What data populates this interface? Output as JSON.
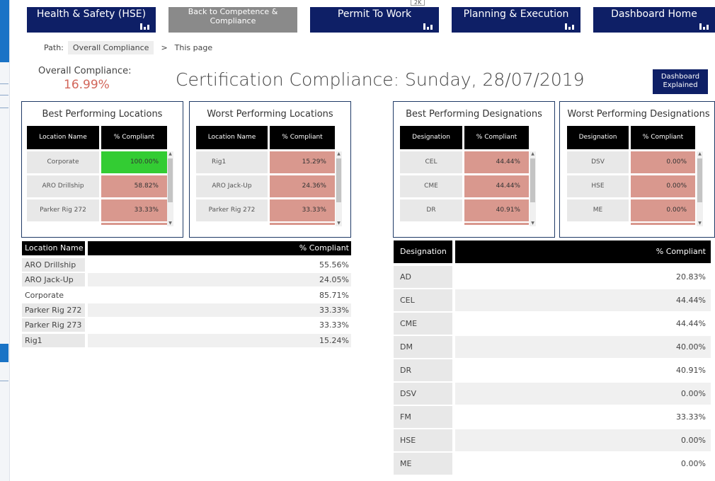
{
  "top_badge": "2K",
  "nav": {
    "hse": "Health & Safety (HSE)",
    "back": "Back to Competence & Compliance",
    "permit": "Permit To Work",
    "planning": "Planning & Execution",
    "home": "Dashboard Home"
  },
  "path": {
    "label": "Path:",
    "crumb": "Overall Compliance",
    "sep": ">",
    "current": "This page"
  },
  "overall": {
    "label": "Overall Compliance:",
    "value": "16.99%"
  },
  "title": "Certification Compliance: Sunday, 28/07/2019",
  "explain_button": "Dashboard Explained",
  "colors": {
    "nav": "#0e1f66",
    "nav_gray": "#8a8a8a",
    "bad": "#d9988e",
    "good": "#33cc33",
    "overall_value": "#d2665a"
  },
  "best_locations": {
    "title": "Best Performing Locations",
    "col_name": "Location Name",
    "col_pct": "% Compliant",
    "rows": [
      {
        "name": "Corporate",
        "pct": "100.00%"
      },
      {
        "name": "ARO Drillship",
        "pct": "58.82%"
      },
      {
        "name": "Parker Rig 272",
        "pct": "33.33%"
      }
    ]
  },
  "worst_locations": {
    "title": "Worst Performing Locations",
    "col_name": "Location Name",
    "col_pct": "% Compliant",
    "rows": [
      {
        "name": "Rig1",
        "pct": "15.29%"
      },
      {
        "name": "ARO Jack-Up",
        "pct": "24.36%"
      },
      {
        "name": "Parker Rig 272",
        "pct": "33.33%"
      }
    ]
  },
  "best_designations": {
    "title": "Best Performing Designations",
    "col_name": "Designation",
    "col_pct": "% Compliant",
    "rows": [
      {
        "name": "CEL",
        "pct": "44.44%"
      },
      {
        "name": "CME",
        "pct": "44.44%"
      },
      {
        "name": "DR",
        "pct": "40.91%"
      }
    ]
  },
  "worst_designations": {
    "title": "Worst Performing Designations",
    "col_name": "Designation",
    "col_pct": "% Compliant",
    "rows": [
      {
        "name": "DSV",
        "pct": "0.00%"
      },
      {
        "name": "HSE",
        "pct": "0.00%"
      },
      {
        "name": "ME",
        "pct": "0.00%"
      }
    ]
  },
  "location_table": {
    "col_name": "Location Name",
    "col_pct": "% Compliant",
    "rows": [
      {
        "name": "ARO Drillship",
        "pct": "55.56%"
      },
      {
        "name": "ARO Jack-Up",
        "pct": "24.05%"
      },
      {
        "name": "Corporate",
        "pct": "85.71%"
      },
      {
        "name": "Parker Rig 272",
        "pct": "33.33%"
      },
      {
        "name": "Parker Rig 273",
        "pct": "33.33%"
      },
      {
        "name": "Rig1",
        "pct": "15.24%"
      }
    ]
  },
  "designation_table": {
    "col_name": "Designation",
    "col_pct": "% Compliant",
    "rows": [
      {
        "name": "AD",
        "pct": "20.83%"
      },
      {
        "name": "CEL",
        "pct": "44.44%"
      },
      {
        "name": "CME",
        "pct": "44.44%"
      },
      {
        "name": "DM",
        "pct": "40.00%"
      },
      {
        "name": "DR",
        "pct": "40.91%"
      },
      {
        "name": "DSV",
        "pct": "0.00%"
      },
      {
        "name": "FM",
        "pct": "33.33%"
      },
      {
        "name": "HSE",
        "pct": "0.00%"
      },
      {
        "name": "ME",
        "pct": "0.00%"
      }
    ]
  }
}
